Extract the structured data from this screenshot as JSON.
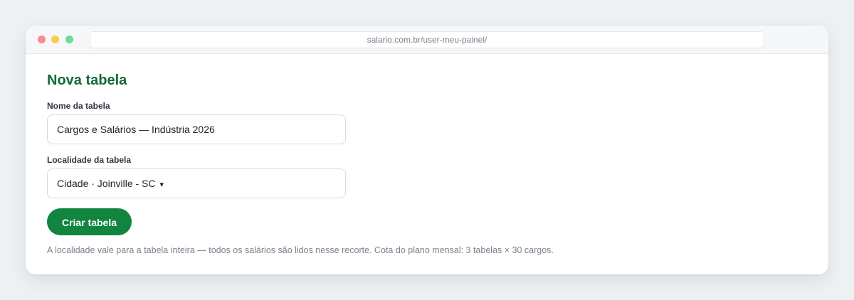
{
  "browser": {
    "url": "salario.com.br/user-meu-painel/"
  },
  "form": {
    "title": "Nova tabela",
    "name_label": "Nome da tabela",
    "name_value": "Cargos e Salários — Indústria 2026",
    "location_label": "Localidade da tabela",
    "location_value": "Cidade · Joinville - SC",
    "location_caret": "▾",
    "submit_label": "Criar tabela",
    "hint": "A localidade vale para a tabela inteira — todos os salários são lidos nesse recorte. Cota do plano mensal: 3 tabelas × 30 cargos."
  },
  "colors": {
    "accent": "#11843f",
    "title": "#12693a",
    "traffic_red": "#f98c8c",
    "traffic_yellow": "#f8cb4d",
    "traffic_green": "#6fdc94"
  }
}
